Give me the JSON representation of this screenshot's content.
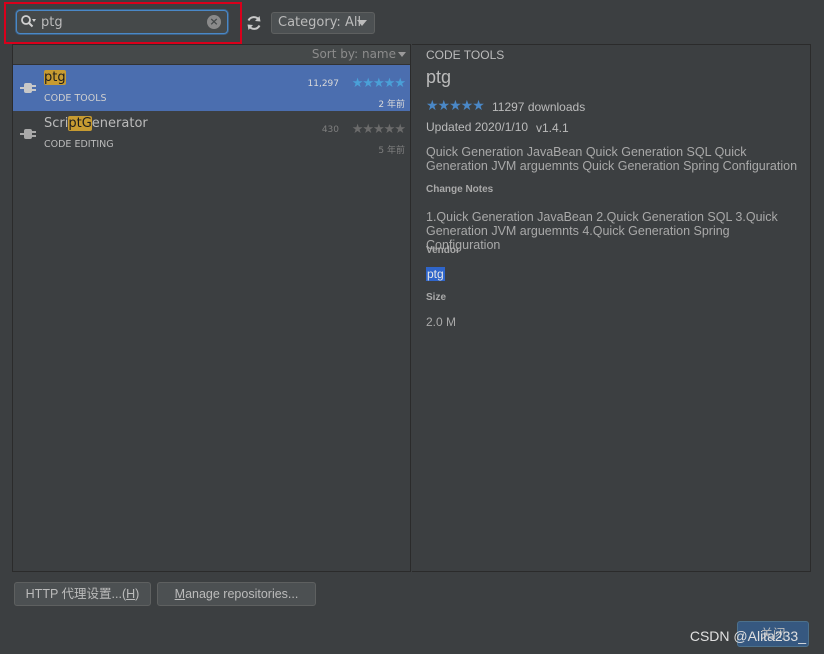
{
  "search": {
    "value": "ptg",
    "placeholder": ""
  },
  "category": {
    "label": "Category: All"
  },
  "sort": {
    "label": "Sort by: name"
  },
  "plugins": [
    {
      "name_pre": "",
      "name_hl": "ptg",
      "name_post": "",
      "category": "CODE TOOLS",
      "downloads": "11,297",
      "rating": "★★★★★",
      "age": "2 年前",
      "selected": true
    },
    {
      "name_pre": "Scri",
      "name_hl": "ptG",
      "name_post": "enerator",
      "category": "CODE EDITING",
      "downloads": "430",
      "rating": "★★★★★",
      "age": "5 年前",
      "selected": false
    }
  ],
  "detail": {
    "category": "CODE TOOLS",
    "name": "ptg",
    "rating": "★★★★★",
    "downloads": "11297 downloads",
    "updated": "Updated 2020/1/10",
    "version": "v1.4.1",
    "description": "Quick Generation JavaBean Quick Generation SQL Quick Generation JVM arguemnts Quick Generation Spring Configuration",
    "change_notes_header": "Change Notes",
    "change_notes": "1.Quick Generation JavaBean 2.Quick Generation SQL 3.Quick Generation JVM arguemnts 4.Quick Generation Spring Configuration",
    "vendor_header": "Vendor",
    "vendor": "ptg",
    "size_header": "Size",
    "size": "2.0 M"
  },
  "buttons": {
    "http_pre": "HTTP 代理设置...(",
    "http_mn": "H",
    "http_post": ")",
    "manage_mn": "M",
    "manage_rest": "anage repositories...",
    "close": "关闭"
  },
  "watermark": "CSDN @Alita233_",
  "colors": {
    "accent": "#4b6eaf",
    "highlight": "#c79b31",
    "frame": "#d9001b",
    "star_active": "#4a88c7",
    "star_inactive": "#6b6b6b"
  }
}
